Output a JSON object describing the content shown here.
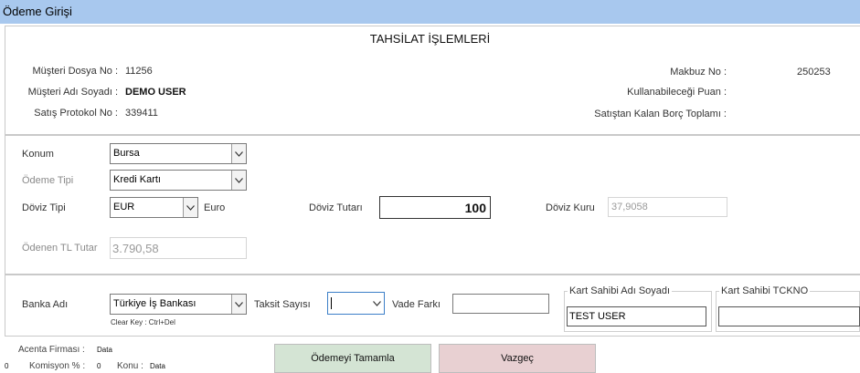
{
  "window": {
    "title": "Ödeme Girişi"
  },
  "header": {
    "title": "TAHSİLAT İŞLEMLERİ",
    "customer_file_no_label": "Müşteri Dosya No :",
    "customer_file_no": "11256",
    "customer_name_label": "Müşteri Adı Soyadı :",
    "customer_name": "DEMO USER",
    "sales_protocol_label": "Satış Protokol No :",
    "sales_protocol": "339411",
    "receipt_no_label": "Makbuz No :",
    "receipt_no": "250253",
    "usable_points_label": "Kullanabileceği Puan :",
    "remaining_debt_label": "Satıştan Kalan Borç Toplamı :"
  },
  "payment": {
    "location_label": "Konum",
    "location_value": "Bursa",
    "payment_type_label": "Ödeme Tipi",
    "payment_type_value": "Kredi Kartı",
    "currency_type_label": "Döviz Tipi",
    "currency_type_value": "EUR",
    "currency_name": "Euro",
    "currency_amount_label": "Döviz Tutarı",
    "currency_amount_value": "100",
    "exchange_rate_label": "Döviz Kuru",
    "exchange_rate_value": "37,9058",
    "paid_tl_label": "Ödenen TL Tutar",
    "paid_tl_value": "3.790,58"
  },
  "bank": {
    "bank_name_label": "Banka Adı",
    "bank_name_value": "Türkiye İş Bankası",
    "clear_key_hint": "Clear Key : Ctrl+Del",
    "installment_label": "Taksit Sayısı",
    "installment_value": "",
    "maturity_diff_label": "Vade Farkı",
    "maturity_diff_value": "",
    "card_holder_label": "Kart Sahibi Adı Soyadı",
    "card_holder_value": "TEST USER",
    "card_holder_tc_label": "Kart Sahibi TCKNO",
    "card_holder_tc_value": ""
  },
  "footer": {
    "agency_label": "Acenta Firması :",
    "agency_value": "Data",
    "commission_prefix": "0",
    "commission_label": "Komisyon % :",
    "commission_value": "0",
    "subject_label": "Konu :",
    "subject_value": "Data",
    "complete_button": "Ödemeyi Tamamla",
    "cancel_button": "Vazgeç",
    "complete_color": "#d4e4d4",
    "cancel_color": "#e8d0d2"
  }
}
